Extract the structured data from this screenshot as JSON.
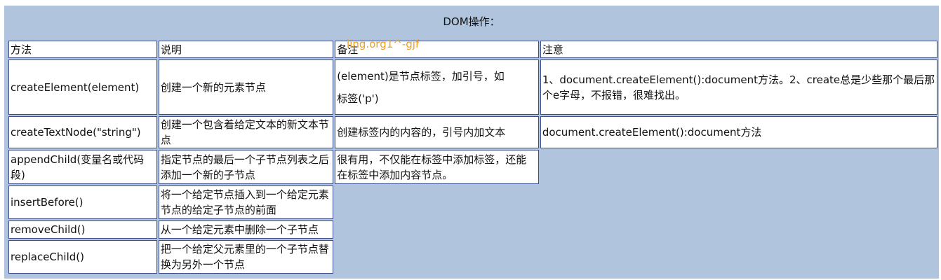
{
  "caption": "DOM操作：",
  "watermark": "ling.org1^-gjf",
  "headers": [
    "方法",
    "说明",
    "备注",
    "注意"
  ],
  "rows": [
    {
      "method": "createElement(element)",
      "desc": "创建一个新的元素节点",
      "remark_line1": "(element)是节点标签，加引号，如",
      "remark_line2": "标签('p')",
      "note": "1、document.createElement():document方法。2、create总是少些那个最后那个e字母，不报错，很难找出。"
    },
    {
      "method": "createTextNode(\"string\")",
      "desc": "创建一个包含着给定文本的新文本节点",
      "remark": "创建标签内的内容的，引号内加文本",
      "note": "document.createElement():document方法"
    },
    {
      "method": "appendChild(变量名或代码段)",
      "desc": "指定节点的最后一个子节点列表之后添加一个新的子节点",
      "remark": "很有用，不仅能在标签中添加标签，还能在标签中添加内容节点。"
    },
    {
      "method": "insertBefore()",
      "desc": "将一个给定节点插入到一个给定元素节点的给定子节点的前面"
    },
    {
      "method": "removeChild()",
      "desc": "从一个给定元素中删除一个子节点"
    },
    {
      "method": "replaceChild()",
      "desc": "把一个给定父元素里的一个子节点替换为另外一个节点"
    }
  ]
}
